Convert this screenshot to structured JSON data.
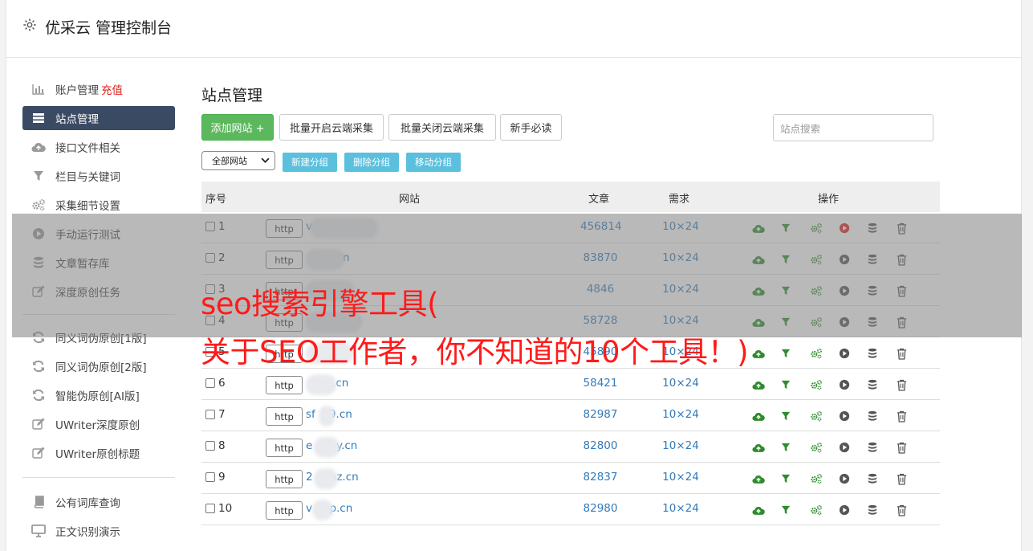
{
  "header": {
    "title": "优采云 管理控制台"
  },
  "sidebar": {
    "items": [
      {
        "label": "账户管理",
        "extra": "充值",
        "icon": "bar-chart-icon"
      },
      {
        "label": "站点管理",
        "icon": "server-icon",
        "active": true
      },
      {
        "label": "接口文件相关",
        "icon": "cloud-upload-icon"
      },
      {
        "label": "栏目与关键词",
        "icon": "filter-icon"
      },
      {
        "label": "采集细节设置",
        "icon": "gears-icon"
      },
      {
        "label": "手动运行测试",
        "icon": "play-circle-icon"
      },
      {
        "label": "文章暂存库",
        "icon": "database-icon"
      },
      {
        "label": "深度原创任务",
        "icon": "edit-icon"
      }
    ],
    "items2": [
      {
        "label": "同义词伪原创[1版]",
        "icon": "refresh-icon"
      },
      {
        "label": "同义词伪原创[2版]",
        "icon": "refresh-icon"
      },
      {
        "label": "智能伪原创[AI版]",
        "icon": "refresh-icon"
      },
      {
        "label": "UWriter深度原创",
        "icon": "edit-icon"
      },
      {
        "label": "UWriter原创标题",
        "icon": "edit-icon"
      }
    ],
    "items3": [
      {
        "label": "公有词库查询",
        "icon": "book-icon"
      },
      {
        "label": "正文识别演示",
        "icon": "monitor-icon"
      }
    ]
  },
  "main": {
    "title": "站点管理",
    "buttons": {
      "add": "添加网站 +",
      "batch_on": "批量开启云端采集",
      "batch_off": "批量关闭云端采集",
      "guide": "新手必读"
    },
    "search_placeholder": "站点搜索",
    "filter_select": "全部网站",
    "group_buttons": {
      "new": "新建分组",
      "delete": "删除分组",
      "move": "移动分组"
    },
    "table": {
      "headers": {
        "no": "序号",
        "site": "网站",
        "articles": "文章",
        "demand": "需求",
        "ops": "操作"
      },
      "rows": [
        {
          "no": "1",
          "proto": "http",
          "site": "v         .com",
          "articles": "456814",
          "demand": "10×24",
          "active": true
        },
        {
          "no": "2",
          "proto": "http",
          "site": "     lit.cn",
          "articles": "83870",
          "demand": "10×24"
        },
        {
          "no": "3",
          "proto": "http",
          "site": "       .cn",
          "articles": "4846",
          "demand": "10×24"
        },
        {
          "no": "4",
          "proto": "http",
          "site": "      pay.cn",
          "articles": "58728",
          "demand": "10×24"
        },
        {
          "no": "5",
          "proto": "http",
          "site": "      's.cn",
          "articles": "45890",
          "demand": "10×24"
        },
        {
          "no": "6",
          "proto": "http",
          "site": "     ik.cn",
          "articles": "58421",
          "demand": "10×24"
        },
        {
          "no": "7",
          "proto": "http",
          "site": "sf  39.cn",
          "articles": "82987",
          "demand": "10×24"
        },
        {
          "no": "8",
          "proto": "http",
          "site": "e     oy.cn",
          "articles": "82800",
          "demand": "10×24"
        },
        {
          "no": "9",
          "proto": "http",
          "site": "2     az.cn",
          "articles": "82837",
          "demand": "10×24"
        },
        {
          "no": "10",
          "proto": "http",
          "site": "v     p.cn",
          "articles": "82980",
          "demand": "10×24"
        }
      ]
    }
  },
  "overlay": {
    "line1": "seo搜索引擎工具(",
    "line2": "关于SEO工作者，你不知道的10个工具！)"
  },
  "colors": {
    "green": "#5cb85c",
    "sidebar_active": "#3b4a63",
    "link": "#337ab7",
    "pill": "#5bc0de",
    "caption": "#ff1a1a",
    "ops_green": "#2e8b2e",
    "ops_red": "#e02020"
  }
}
